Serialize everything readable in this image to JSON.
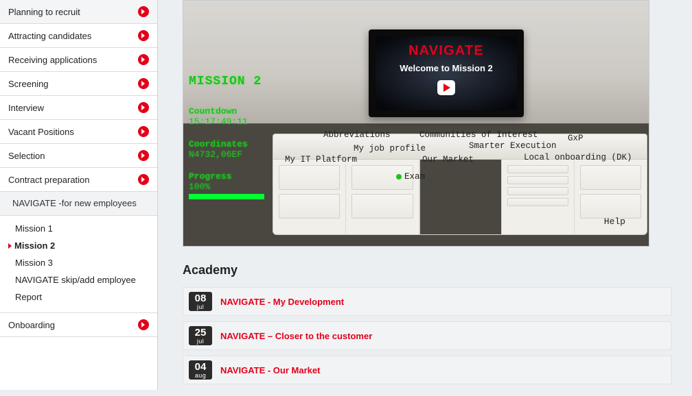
{
  "sidebar": {
    "items": [
      {
        "label": "Planning to recruit"
      },
      {
        "label": "Attracting candidates"
      },
      {
        "label": "Receiving applications"
      },
      {
        "label": "Screening"
      },
      {
        "label": "Interview"
      },
      {
        "label": "Vacant Positions"
      },
      {
        "label": "Selection"
      },
      {
        "label": "Contract preparation"
      }
    ],
    "sub_head": "NAVIGATE -for new employees",
    "sub_items": [
      {
        "label": "Mission 1",
        "active": false
      },
      {
        "label": "Mission 2",
        "active": true
      },
      {
        "label": "Mission 3",
        "active": false
      },
      {
        "label": "NAVIGATE skip/add employee",
        "active": false
      },
      {
        "label": "Report",
        "active": false
      }
    ],
    "tail": [
      {
        "label": "Onboarding"
      }
    ]
  },
  "mission": {
    "title": "MISSION 2",
    "countdown_label": "Countdown",
    "countdown_value": "15:17:49:11",
    "coords_label": "Coordinates",
    "coords_value": "N4732,06EF",
    "progress_label": "Progress",
    "progress_value": "100%",
    "tv_brand": "NAVIGATE",
    "tv_welcome": "Welcome to Mission 2",
    "labels": {
      "abbrev": "Abbreviations",
      "communities": "Communities of Interest",
      "gxp": "GxP",
      "myjob": "My job profile",
      "smarter": "Smarter Execution",
      "itplat": "My IT Platform",
      "market": "Our Market",
      "local_on": "Local onboarding (DK)",
      "exam": "Exam",
      "help": "Help"
    }
  },
  "academy": {
    "heading": "Academy",
    "items": [
      {
        "day": "08",
        "mon": "jul",
        "title": "NAVIGATE - My Development"
      },
      {
        "day": "25",
        "mon": "jul",
        "title": "NAVIGATE – Closer to the customer"
      },
      {
        "day": "04",
        "mon": "aug",
        "title": "NAVIGATE - Our Market"
      }
    ]
  }
}
